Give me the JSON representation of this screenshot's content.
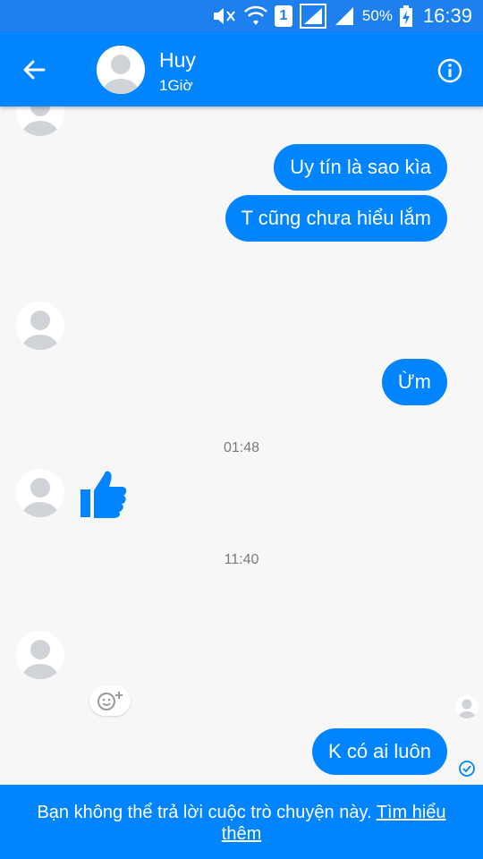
{
  "status_bar": {
    "sim_slot": "1",
    "battery": "50%",
    "time": "16:39"
  },
  "header": {
    "contact_name": "Huy",
    "contact_status": "1Giờ",
    "icons": [
      "back-arrow-icon",
      "avatar",
      "info-icon"
    ]
  },
  "messages": [
    {
      "side": "right",
      "text": "Uy tín là sao kìa"
    },
    {
      "side": "right",
      "text": "T cũng chưa hiểu lắm"
    },
    {
      "side": "right",
      "text": "Ừm"
    },
    {
      "timestamp": "01:48"
    },
    {
      "side": "left",
      "type": "like",
      "icon": "thumbs-up-icon"
    },
    {
      "timestamp": "11:40"
    },
    {
      "side": "right",
      "text": "K có ai luôn"
    }
  ],
  "timestamps": [
    "01:48",
    "11:40"
  ],
  "footer": {
    "notice": "Bạn không thể trả lời cuộc trò chuyện này.",
    "link": "Tìm hiểu thêm"
  },
  "colors": {
    "brand": "#0084ff",
    "status_bar": "#1e7fef",
    "background": "#f7f7f7"
  }
}
